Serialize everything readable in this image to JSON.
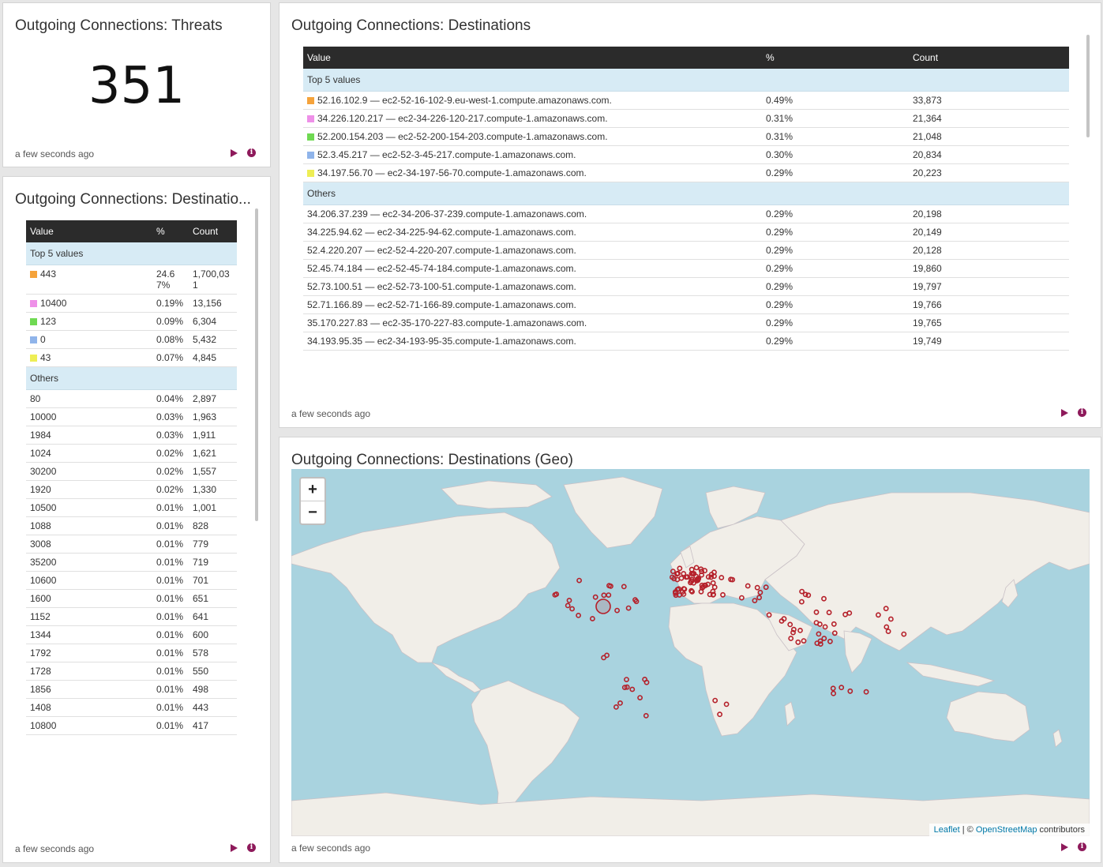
{
  "colors": {
    "accent": "#8e1a5b",
    "header_bg": "#2b2b2b",
    "group_bg": "#d7ebf5",
    "marker": "#b5202a",
    "water": "#a9d3df",
    "land": "#f1eee8"
  },
  "threats": {
    "title": "Outgoing Connections: Threats",
    "value": "351",
    "time": "a few seconds ago"
  },
  "ports": {
    "title": "Outgoing Connections: Destinatio...",
    "time": "a few seconds ago",
    "headers": {
      "value": "Value",
      "pct": "%",
      "count": "Count"
    },
    "top_label": "Top 5 values",
    "others_label": "Others",
    "top": [
      {
        "value": "443",
        "pct": "24.6\n7%",
        "count": "1,700,03\n1",
        "color": "#f5a33b"
      },
      {
        "value": "10400",
        "pct": "0.19%",
        "count": "13,156",
        "color": "#ee90e8"
      },
      {
        "value": "123",
        "pct": "0.09%",
        "count": "6,304",
        "color": "#6fd952"
      },
      {
        "value": "0",
        "pct": "0.08%",
        "count": "5,432",
        "color": "#8fb4ea"
      },
      {
        "value": "43",
        "pct": "0.07%",
        "count": "4,845",
        "color": "#eeee55"
      }
    ],
    "others": [
      {
        "value": "80",
        "pct": "0.04%",
        "count": "2,897"
      },
      {
        "value": "10000",
        "pct": "0.03%",
        "count": "1,963"
      },
      {
        "value": "1984",
        "pct": "0.03%",
        "count": "1,911"
      },
      {
        "value": "1024",
        "pct": "0.02%",
        "count": "1,621"
      },
      {
        "value": "30200",
        "pct": "0.02%",
        "count": "1,557"
      },
      {
        "value": "1920",
        "pct": "0.02%",
        "count": "1,330"
      },
      {
        "value": "10500",
        "pct": "0.01%",
        "count": "1,001"
      },
      {
        "value": "1088",
        "pct": "0.01%",
        "count": "828"
      },
      {
        "value": "3008",
        "pct": "0.01%",
        "count": "779"
      },
      {
        "value": "35200",
        "pct": "0.01%",
        "count": "719"
      },
      {
        "value": "10600",
        "pct": "0.01%",
        "count": "701"
      },
      {
        "value": "1600",
        "pct": "0.01%",
        "count": "651"
      },
      {
        "value": "1152",
        "pct": "0.01%",
        "count": "641"
      },
      {
        "value": "1344",
        "pct": "0.01%",
        "count": "600"
      },
      {
        "value": "1792",
        "pct": "0.01%",
        "count": "578"
      },
      {
        "value": "1728",
        "pct": "0.01%",
        "count": "550"
      },
      {
        "value": "1856",
        "pct": "0.01%",
        "count": "498"
      },
      {
        "value": "1408",
        "pct": "0.01%",
        "count": "443"
      },
      {
        "value": "10800",
        "pct": "0.01%",
        "count": "417"
      }
    ]
  },
  "dest": {
    "title": "Outgoing Connections: Destinations",
    "time": "a few seconds ago",
    "headers": {
      "value": "Value",
      "pct": "%",
      "count": "Count"
    },
    "top_label": "Top 5 values",
    "others_label": "Others",
    "top": [
      {
        "value": "52.16.102.9 — ec2-52-16-102-9.eu-west-1.compute.amazonaws.com.",
        "pct": "0.49%",
        "count": "33,873",
        "color": "#f5a33b"
      },
      {
        "value": "34.226.120.217 — ec2-34-226-120-217.compute-1.amazonaws.com.",
        "pct": "0.31%",
        "count": "21,364",
        "color": "#ee90e8"
      },
      {
        "value": "52.200.154.203 — ec2-52-200-154-203.compute-1.amazonaws.com.",
        "pct": "0.31%",
        "count": "21,048",
        "color": "#6fd952"
      },
      {
        "value": "52.3.45.217 — ec2-52-3-45-217.compute-1.amazonaws.com.",
        "pct": "0.30%",
        "count": "20,834",
        "color": "#8fb4ea"
      },
      {
        "value": "34.197.56.70 — ec2-34-197-56-70.compute-1.amazonaws.com.",
        "pct": "0.29%",
        "count": "20,223",
        "color": "#eeee55"
      }
    ],
    "others": [
      {
        "value": "34.206.37.239 — ec2-34-206-37-239.compute-1.amazonaws.com.",
        "pct": "0.29%",
        "count": "20,198"
      },
      {
        "value": "34.225.94.62 — ec2-34-225-94-62.compute-1.amazonaws.com.",
        "pct": "0.29%",
        "count": "20,149"
      },
      {
        "value": "52.4.220.207 — ec2-52-4-220-207.compute-1.amazonaws.com.",
        "pct": "0.29%",
        "count": "20,128"
      },
      {
        "value": "52.45.74.184 — ec2-52-45-74-184.compute-1.amazonaws.com.",
        "pct": "0.29%",
        "count": "19,860"
      },
      {
        "value": "52.73.100.51 — ec2-52-73-100-51.compute-1.amazonaws.com.",
        "pct": "0.29%",
        "count": "19,797"
      },
      {
        "value": "52.71.166.89 — ec2-52-71-166-89.compute-1.amazonaws.com.",
        "pct": "0.29%",
        "count": "19,766"
      },
      {
        "value": "35.170.227.83 — ec2-35-170-227-83.compute-1.amazonaws.com.",
        "pct": "0.29%",
        "count": "19,765"
      },
      {
        "value": "34.193.95.35 — ec2-34-193-95-35.compute-1.amazonaws.com.",
        "pct": "0.29%",
        "count": "19,749"
      }
    ]
  },
  "geo": {
    "title": "Outgoing Connections: Destinations (Geo)",
    "time": "a few seconds ago",
    "zoom_in": "+",
    "zoom_out": "−",
    "attribution": {
      "leaflet": "Leaflet",
      "sep": " | © ",
      "osm": "OpenStreetMap",
      "suffix": " contributors"
    }
  }
}
